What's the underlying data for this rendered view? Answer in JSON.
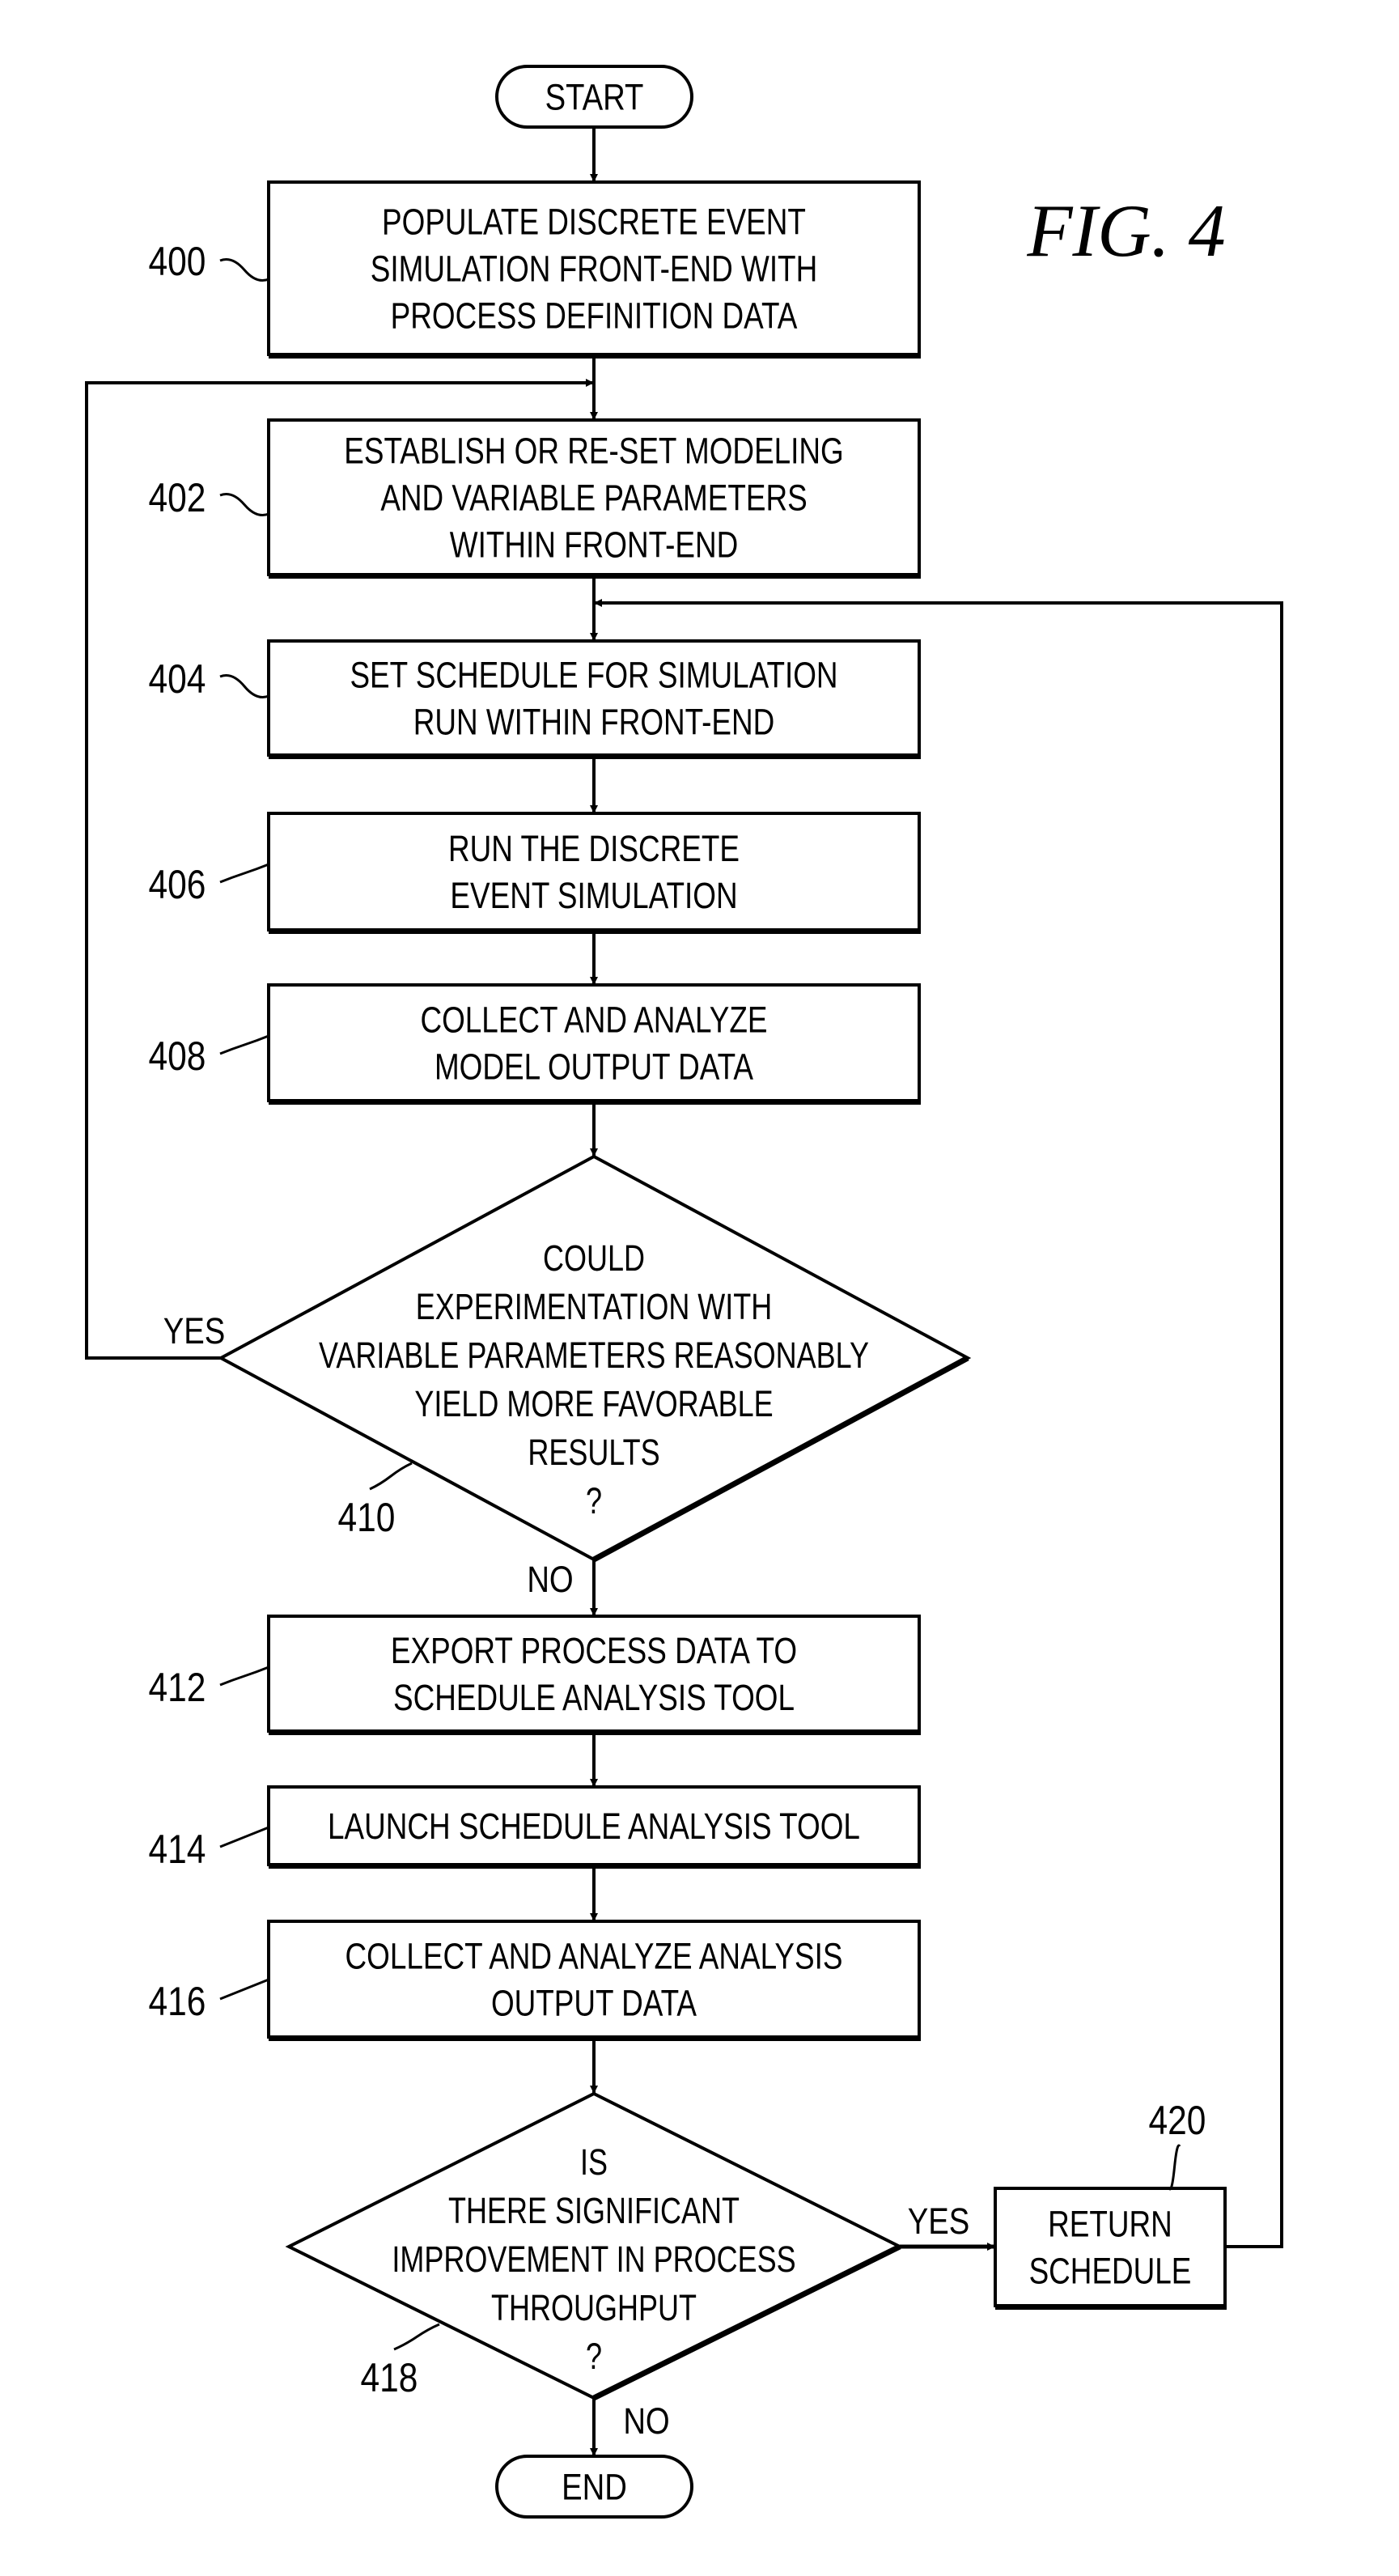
{
  "figure": {
    "title": "FIG. 4",
    "text_color": "#000000",
    "line_color": "#000000",
    "background": "#ffffff"
  },
  "terminals": {
    "start": {
      "id": "start",
      "label": "START"
    },
    "end": {
      "id": "end",
      "label": "END"
    }
  },
  "steps": [
    {
      "ref": "400",
      "lines": [
        "POPULATE DISCRETE EVENT",
        "SIMULATION FRONT-END WITH",
        "PROCESS DEFINITION DATA"
      ]
    },
    {
      "ref": "402",
      "lines": [
        "ESTABLISH OR RE-SET MODELING",
        "AND VARIABLE PARAMETERS",
        "WITHIN FRONT-END"
      ]
    },
    {
      "ref": "404",
      "lines": [
        "SET SCHEDULE FOR SIMULATION",
        "RUN WITHIN FRONT-END"
      ]
    },
    {
      "ref": "406",
      "lines": [
        "RUN THE DISCRETE",
        "EVENT SIMULATION"
      ]
    },
    {
      "ref": "408",
      "lines": [
        "COLLECT AND ANALYZE",
        "MODEL OUTPUT DATA"
      ]
    },
    {
      "ref": "412",
      "lines": [
        "EXPORT PROCESS DATA TO",
        "SCHEDULE ANALYSIS TOOL"
      ]
    },
    {
      "ref": "414",
      "lines": [
        "LAUNCH SCHEDULE ANALYSIS TOOL"
      ]
    },
    {
      "ref": "416",
      "lines": [
        "COLLECT AND ANALYZE ANALYSIS",
        "OUTPUT DATA"
      ]
    },
    {
      "ref": "420",
      "lines": [
        "RETURN",
        "SCHEDULE"
      ]
    }
  ],
  "decisions": [
    {
      "ref": "410",
      "lines": [
        "COULD",
        "EXPERIMENTATION WITH",
        "VARIABLE PARAMETERS REASONABLY",
        "YIELD MORE FAVORABLE",
        "RESULTS",
        "?"
      ],
      "yes_label": "YES",
      "no_label": "NO",
      "yes_target": "402",
      "no_target": "412"
    },
    {
      "ref": "418",
      "lines": [
        "IS",
        "THERE SIGNIFICANT",
        "IMPROVEMENT IN PROCESS",
        "THROUGHPUT",
        "?"
      ],
      "yes_label": "YES",
      "no_label": "NO",
      "yes_target": "420",
      "no_target": "end"
    }
  ],
  "return_paths": [
    {
      "from": "420",
      "to": "404"
    }
  ]
}
